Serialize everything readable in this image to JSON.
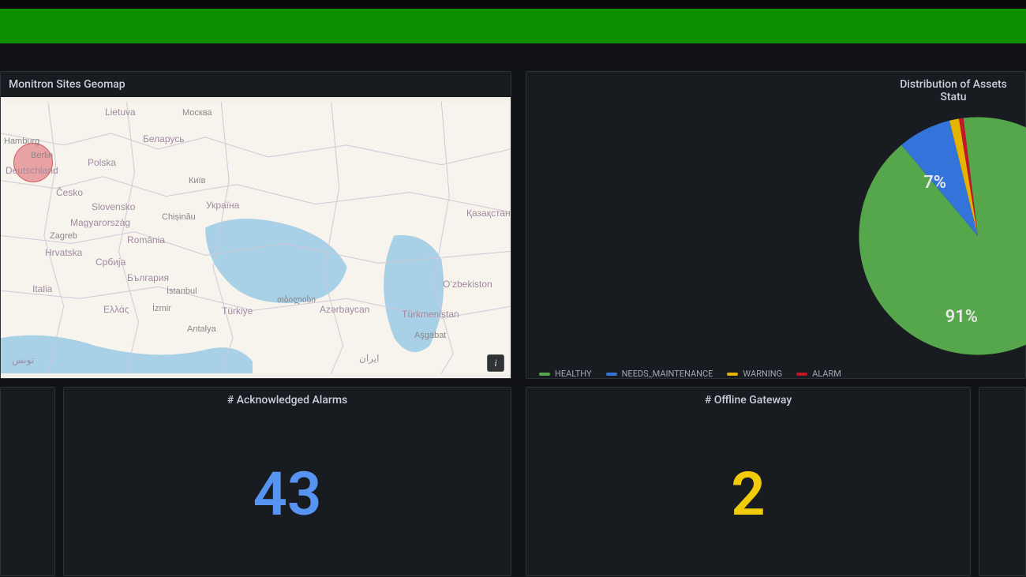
{
  "banner": {},
  "panels": {
    "geomap": {
      "title": "Monitron Sites Geomap",
      "info_icon": "i",
      "map_labels": {
        "moskva": "Москва",
        "lietuva": "Lietuva",
        "berlin": "Berlin",
        "hamburg": "Hamburg",
        "deutschland": "Deutschland",
        "polska": "Polska",
        "belarus": "Беларусь",
        "cesko": "Česko",
        "slovensko": "Slovensko",
        "magyar": "Magyarország",
        "zagreb": "Zagreb",
        "hrvatska": "Hrvatska",
        "romania": "România",
        "srbija": "Србија",
        "bulgaria": "България",
        "italia": "Italia",
        "ellas": "Ελλάς",
        "izmir": "İzmir",
        "istanbul": "İstanbul",
        "antalya": "Antalya",
        "turkiye": "Türkiye",
        "kyiv": "Київ",
        "ukraina": "Україна",
        "chisinau": "Chișinău",
        "tbilisi": "თბილისი",
        "azerbaijan": "Azərbaycan",
        "turkmenistan": "Türkmenistan",
        "uzbekistan": "Oʻzbekiston",
        "kazakhstan": "Қазақстан",
        "iran": "ایران",
        "asgabat": "Aşgabat",
        "tounes": "تونس"
      }
    },
    "ack_alarms": {
      "title": "# Acknowledged Alarms",
      "value": "43"
    },
    "offline_gateway": {
      "title": "# Offline Gateway",
      "value": "2"
    },
    "pie": {
      "title": "Distribution of Assets Statu",
      "labels": {
        "healthy_pct": "91%",
        "maint_pct": "7%"
      },
      "legend": [
        {
          "label": "HEALTHY",
          "color": "#56a64b"
        },
        {
          "label": "NEEDS_MAINTENANCE",
          "color": "#3274d9"
        },
        {
          "label": "WARNING",
          "color": "#e5b400"
        },
        {
          "label": "ALARM",
          "color": "#c4162a"
        }
      ]
    }
  },
  "chart_data": {
    "type": "pie",
    "title": "Distribution of Assets Status",
    "series": [
      {
        "name": "HEALTHY",
        "value": 91,
        "color": "#56a64b"
      },
      {
        "name": "NEEDS_MAINTENANCE",
        "value": 7,
        "color": "#3274d9"
      },
      {
        "name": "WARNING",
        "value": 1.3,
        "color": "#e5b400"
      },
      {
        "name": "ALARM",
        "value": 0.7,
        "color": "#c4162a"
      }
    ]
  }
}
